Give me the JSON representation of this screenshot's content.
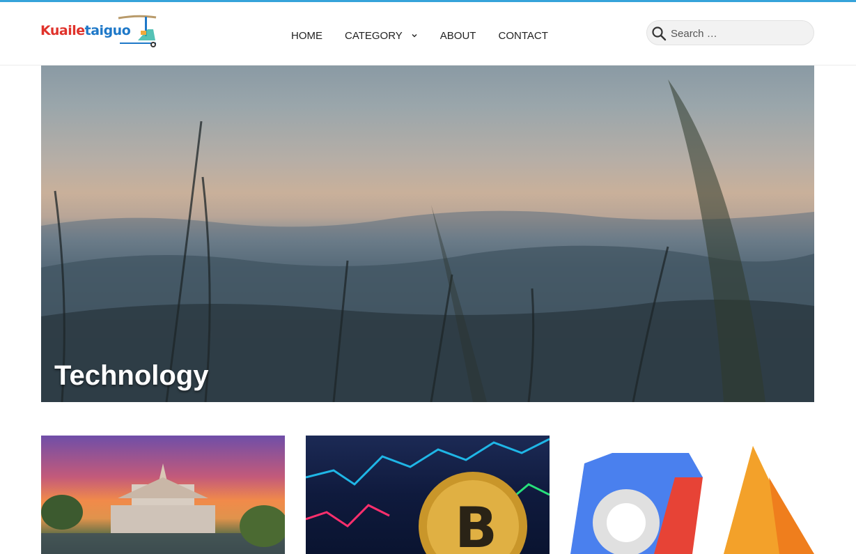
{
  "brand": {
    "logo_text_part1": "Kuaile",
    "logo_text_part2": "taiguo",
    "colors": {
      "red": "#e0322b",
      "blue": "#1e78c8",
      "teal": "#2bb3a4"
    }
  },
  "nav": {
    "items": [
      {
        "label": "HOME"
      },
      {
        "label": "CATEGORY",
        "has_dropdown": true
      },
      {
        "label": "ABOUT"
      },
      {
        "label": "CONTACT"
      }
    ]
  },
  "search": {
    "placeholder": "Search …",
    "value": ""
  },
  "hero": {
    "title": "Technology"
  },
  "cards": [
    {
      "image": "thai-temple-sunset"
    },
    {
      "image": "bitcoin-chart"
    },
    {
      "image": "google-cloud-firebase-logos"
    }
  ],
  "accent_color": "#36a3da"
}
